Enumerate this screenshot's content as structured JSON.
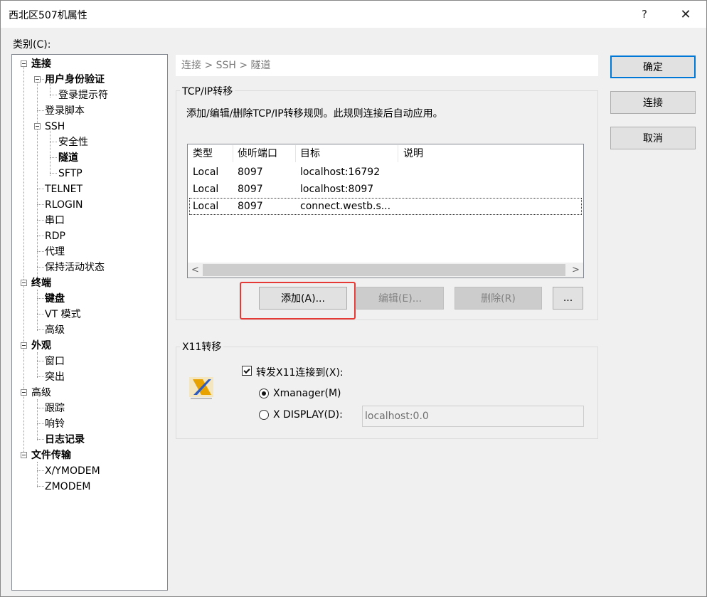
{
  "window": {
    "title": "西北区507机属性",
    "help_symbol": "?",
    "close_symbol": "✕"
  },
  "category_label": "类别(C):",
  "tree": {
    "items": [
      {
        "label": "连接",
        "bold": true
      },
      {
        "label": "用户身份验证",
        "bold": true
      },
      {
        "label": "登录提示符",
        "bold": false
      },
      {
        "label": "登录脚本",
        "bold": false
      },
      {
        "label": "SSH",
        "bold": false
      },
      {
        "label": "安全性",
        "bold": false
      },
      {
        "label": "隧道",
        "bold": true
      },
      {
        "label": "SFTP",
        "bold": false
      },
      {
        "label": "TELNET",
        "bold": false
      },
      {
        "label": "RLOGIN",
        "bold": false
      },
      {
        "label": "串口",
        "bold": false
      },
      {
        "label": "RDP",
        "bold": false
      },
      {
        "label": "代理",
        "bold": false
      },
      {
        "label": "保持活动状态",
        "bold": false
      },
      {
        "label": "终端",
        "bold": true
      },
      {
        "label": "键盘",
        "bold": true
      },
      {
        "label": "VT 模式",
        "bold": false
      },
      {
        "label": "高级",
        "bold": false
      },
      {
        "label": "外观",
        "bold": true
      },
      {
        "label": "窗口",
        "bold": false
      },
      {
        "label": "突出",
        "bold": false
      },
      {
        "label": "高级",
        "bold": false
      },
      {
        "label": "跟踪",
        "bold": false
      },
      {
        "label": "响铃",
        "bold": false
      },
      {
        "label": "日志记录",
        "bold": true
      },
      {
        "label": "文件传输",
        "bold": true
      },
      {
        "label": "X/YMODEM",
        "bold": false
      },
      {
        "label": "ZMODEM",
        "bold": false
      }
    ]
  },
  "breadcrumb": "连接 > SSH > 隧道",
  "tcpip": {
    "group_title": "TCP/IP转移",
    "description": "添加/编辑/删除TCP/IP转移规则。此规则连接后自动应用。",
    "columns": [
      "类型",
      "侦听端口",
      "目标",
      "说明"
    ],
    "rows": [
      [
        "Local",
        "8097",
        "localhost:16792",
        ""
      ],
      [
        "Local",
        "8097",
        "localhost:8097",
        ""
      ],
      [
        "Local",
        "8097",
        "connect.westb.s...",
        ""
      ]
    ],
    "buttons": {
      "add": "添加(A)...",
      "edit": "编辑(E)...",
      "delete": "删除(R)",
      "more": "..."
    },
    "scroll_left": "<",
    "scroll_right": ">"
  },
  "x11": {
    "group_title": "X11转移",
    "forward_label": "转发X11连接到(X):",
    "forward_checked": true,
    "option_xmanager": "Xmanager(M)",
    "option_display": "X DISPLAY(D):",
    "selected_option": "Xmanager(M)",
    "display_value": "localhost:0.0"
  },
  "dialog_buttons": {
    "ok": "确定",
    "connect": "连接",
    "cancel": "取消"
  },
  "colors": {
    "highlight": "#e53935",
    "accent": "#0078d7"
  }
}
